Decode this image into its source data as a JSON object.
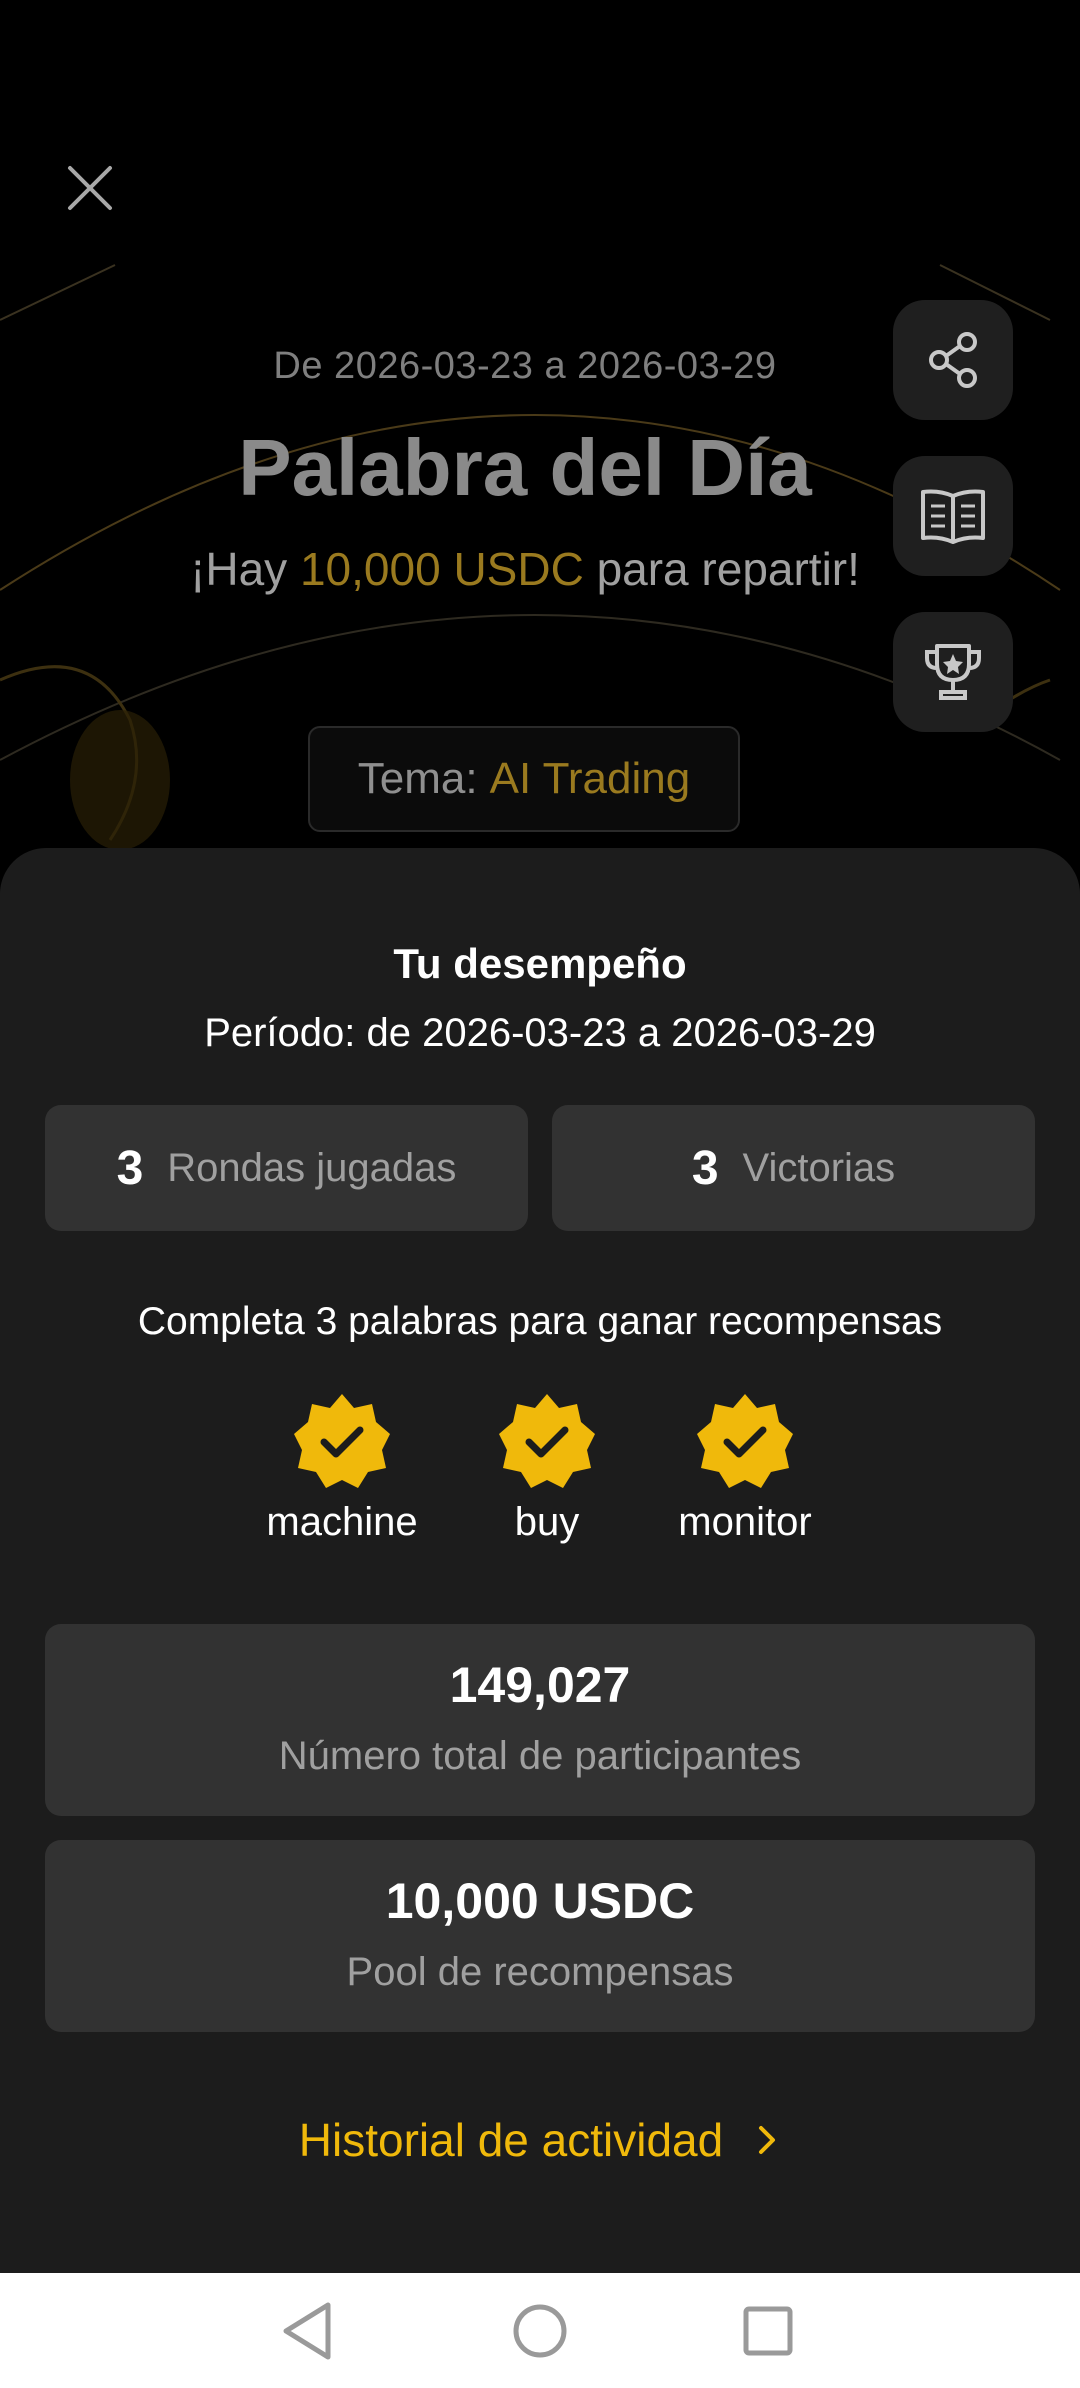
{
  "hero": {
    "date_range": "De 2026-03-23 a 2026-03-29",
    "title": "Palabra del Día",
    "subtitle_pre": "¡Hay ",
    "subtitle_amount": "10,000 USDC",
    "subtitle_post": " para repartir!",
    "theme_label": "Tema:",
    "theme_value": "AI Trading"
  },
  "side_actions": [
    {
      "icon": "share-icon"
    },
    {
      "icon": "rules-book-icon"
    },
    {
      "icon": "trophy-icon"
    }
  ],
  "performance": {
    "title": "Tu desempeño",
    "period": "Período: de 2026-03-23 a 2026-03-29",
    "rounds_count": "3",
    "rounds_label": "Rondas jugadas",
    "wins_count": "3",
    "wins_label": "Victorias",
    "complete_text": "Completa 3 palabras para ganar recompensas",
    "words": [
      "machine",
      "buy",
      "monitor"
    ],
    "participants_value": "149,027",
    "participants_label": "Número total de participantes",
    "pool_value": "10,000 USDC",
    "pool_label": "Pool de recompensas",
    "history_link": "Historial de actividad"
  },
  "colors": {
    "accent": "#f0b90b",
    "accent_dim": "#9a7a1f",
    "sheet_bg": "#1c1c1c",
    "card_bg": "#323232"
  }
}
